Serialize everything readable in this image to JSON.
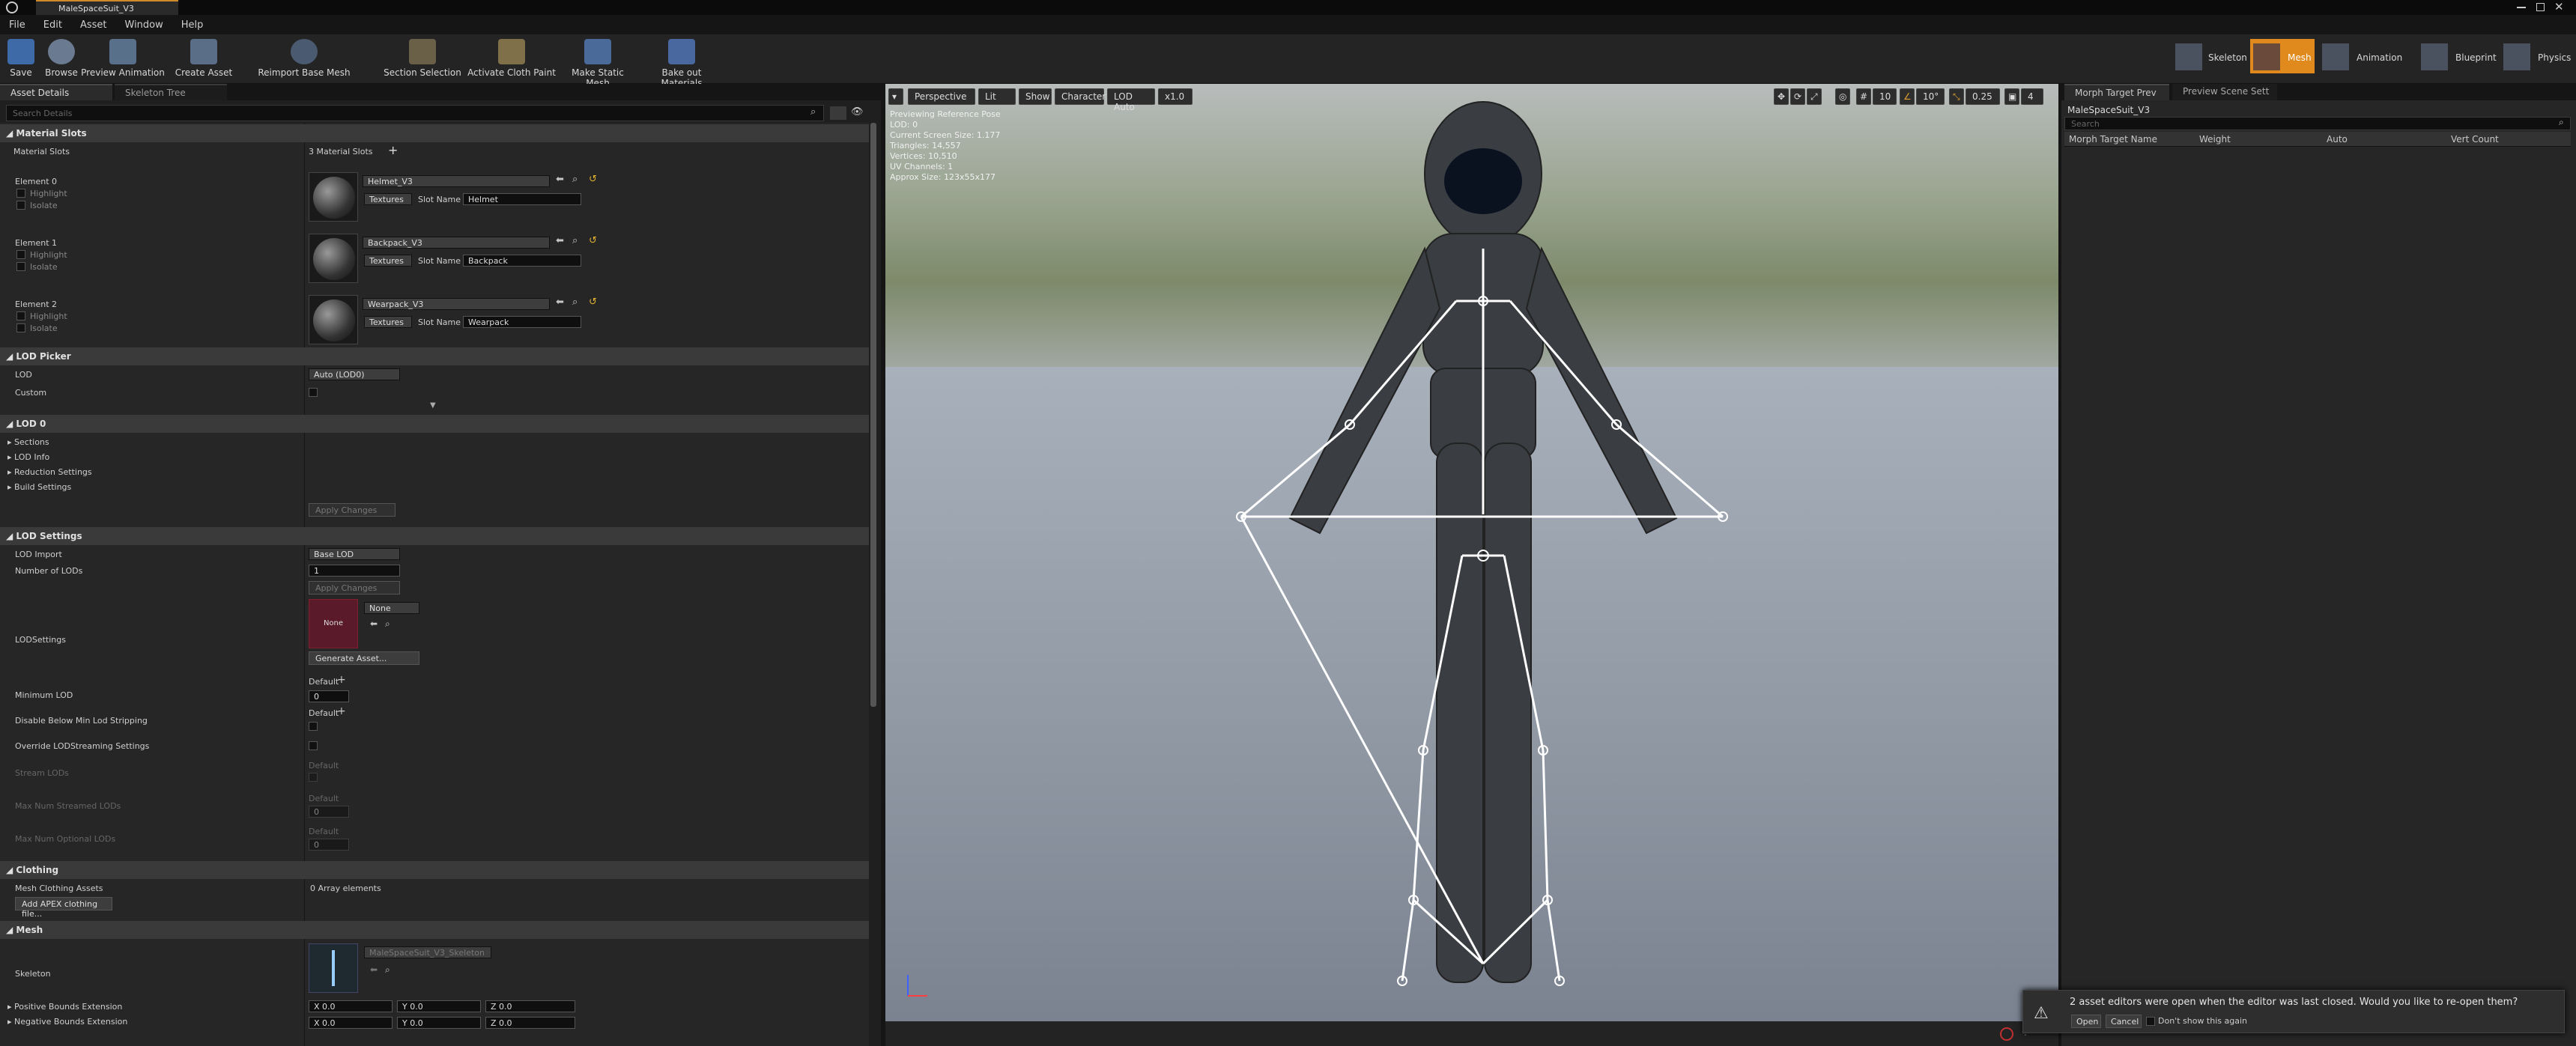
{
  "window": {
    "doc_tab": "MaleSpaceSuit_V3"
  },
  "menu": [
    "File",
    "Edit",
    "Asset",
    "Window",
    "Help"
  ],
  "toolbar": {
    "save": "Save",
    "browse": "Browse",
    "preview_animation": "Preview Animation",
    "create_asset": "Create Asset",
    "reimport": "Reimport Base Mesh",
    "section_selection": "Section Selection",
    "activate_cloth": "Activate Cloth Paint",
    "make_static": "Make Static Mesh",
    "bake_out": "Bake out Materials"
  },
  "modes": {
    "skeleton": "Skeleton",
    "mesh": "Mesh",
    "animation": "Animation",
    "blueprint": "Blueprint",
    "physics": "Physics"
  },
  "left_panel": {
    "tabs": [
      "Asset Details",
      "Skeleton Tree"
    ],
    "search_placeholder": "Search Details",
    "material_slots": {
      "header": "Material Slots",
      "label": "Material Slots",
      "count": "3 Material Slots",
      "elements": [
        {
          "label": "Element 0",
          "material": "Helmet_V3",
          "slot_name_label": "Slot Name",
          "slot_name": "Helmet",
          "textures": "Textures"
        },
        {
          "label": "Element 1",
          "material": "Backpack_V3",
          "slot_name_label": "Slot Name",
          "slot_name": "Backpack",
          "textures": "Textures"
        },
        {
          "label": "Element 2",
          "material": "Wearpack_V3",
          "slot_name_label": "Slot Name",
          "slot_name": "Wearpack",
          "textures": "Textures"
        }
      ],
      "highlight": "Highlight",
      "isolate": "Isolate"
    },
    "lod_picker": {
      "header": "LOD Picker",
      "lod_label": "LOD",
      "lod_value": "Auto (LOD0)",
      "custom_label": "Custom"
    },
    "lod0": {
      "header": "LOD 0",
      "items": [
        "Sections",
        "LOD Info",
        "Reduction Settings",
        "Build Settings"
      ],
      "apply": "Apply Changes"
    },
    "lod_settings": {
      "header": "LOD Settings",
      "lod_import": "LOD Import",
      "lod_import_value": "Base LOD",
      "num_lods": "Number of LODs",
      "num_lods_value": "1",
      "apply": "Apply Changes",
      "lodsettings_label": "LODSettings",
      "none_thumb": "None",
      "none_combo": "None",
      "generate": "Generate Asset...",
      "min_lod": "Minimum LOD",
      "default": "Default",
      "min_lod_value": "0",
      "disable_below": "Disable Below Min Lod Stripping",
      "override_streaming": "Override LODStreaming Settings",
      "stream_lods": "Stream LODs",
      "max_streamed": "Max Num Streamed LODs",
      "max_streamed_value": "0",
      "max_optional": "Max Num Optional LODs",
      "max_optional_value": "0"
    },
    "clothing": {
      "header": "Clothing",
      "mesh_clothing": "Mesh Clothing Assets",
      "mesh_clothing_value": "0 Array elements",
      "add_apex": "Add APEX clothing file..."
    },
    "mesh": {
      "header": "Mesh",
      "skeleton_label": "Skeleton",
      "skeleton_value": "MaleSpaceSuit_V3_Skeleton",
      "pos_bounds": "Positive Bounds Extension",
      "neg_bounds": "Negative Bounds Extension",
      "x": "X",
      "y": "Y",
      "z": "Z",
      "zero": "0.0"
    }
  },
  "viewport": {
    "perspective": "Perspective",
    "lit": "Lit",
    "show": "Show",
    "character": "Character",
    "lod_auto": "LOD Auto",
    "speed": "x1.0",
    "grid_num": "10",
    "angle": "10°",
    "scale": "0.25",
    "cam_speed": "4",
    "info": [
      "Previewing Reference Pose",
      "LOD: 0",
      "Current Screen Size: 1.177",
      "Triangles: 14,557",
      "Vertices: 10,510",
      "UV Channels: 1",
      "Approx Size: 123x55x177"
    ]
  },
  "right_panel": {
    "tabs": [
      "Morph Target Prev",
      "Preview Scene Sett"
    ],
    "asset": "MaleSpaceSuit_V3",
    "search_placeholder": "Search",
    "columns": [
      "Morph Target Name",
      "Weight",
      "Auto",
      "Vert Count"
    ]
  },
  "notification": {
    "message": "2 asset editors were open when the editor was last closed. Would you like to re-open them?",
    "open": "Open",
    "cancel": "Cancel",
    "dont_show": "Don't show this again"
  }
}
